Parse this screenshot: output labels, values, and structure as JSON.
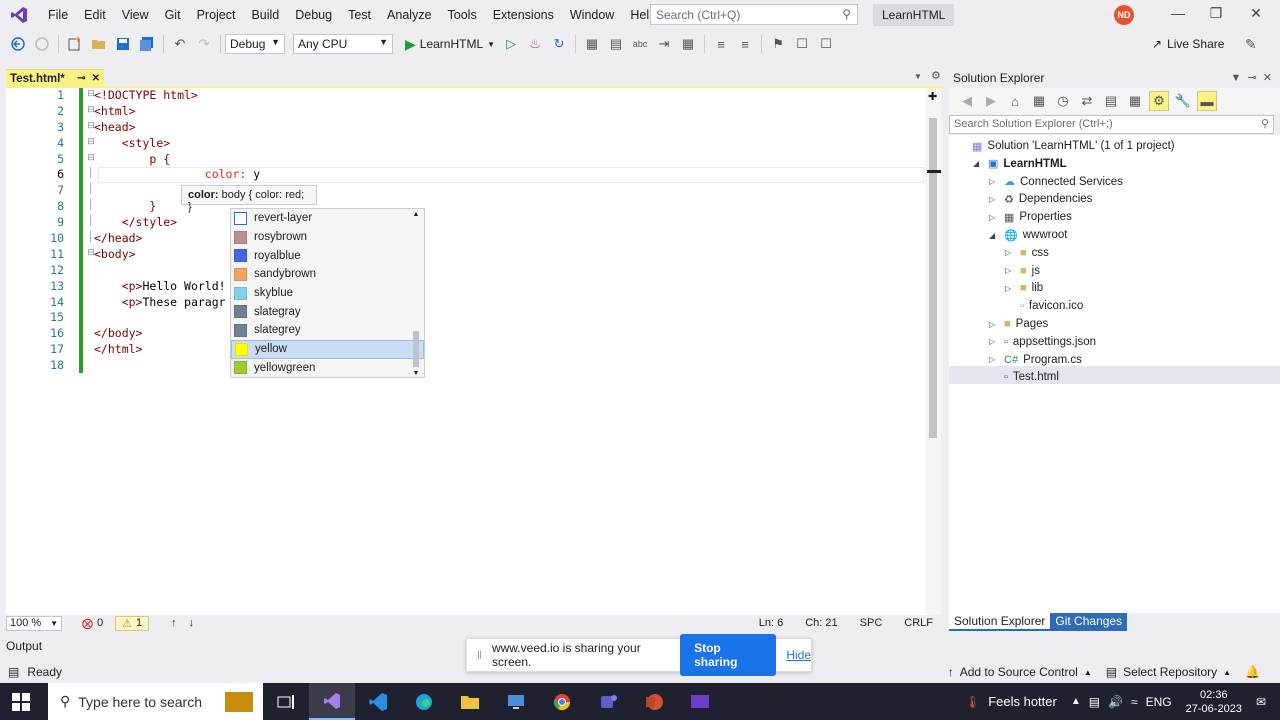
{
  "menubar": {
    "items": [
      "File",
      "Edit",
      "View",
      "Git",
      "Project",
      "Build",
      "Debug",
      "Test",
      "Analyze",
      "Tools",
      "Extensions",
      "Window",
      "Help"
    ],
    "search_placeholder": "Search (Ctrl+Q)",
    "solution_name": "LearnHTML",
    "avatar_initials": "ND"
  },
  "toolbar": {
    "config": "Debug",
    "platform": "Any CPU",
    "run_target": "LearnHTML",
    "live_share": "Live Share"
  },
  "editor": {
    "tab_title": "Test.html*",
    "line_numbers": [
      "1",
      "2",
      "3",
      "4",
      "5",
      "6",
      "7",
      "8",
      "9",
      "10",
      "11",
      "12",
      "13",
      "14",
      "15",
      "16",
      "17",
      "18"
    ],
    "lines": [
      {
        "segs": [
          {
            "t": "<!DOCTYPE html>",
            "c": "tag"
          }
        ]
      },
      {
        "segs": [
          {
            "t": "<html>",
            "c": "tag"
          }
        ]
      },
      {
        "segs": [
          {
            "t": "<head>",
            "c": "tag"
          }
        ]
      },
      {
        "segs": [
          {
            "t": "    "
          },
          {
            "t": "<style>",
            "c": "tag"
          }
        ]
      },
      {
        "segs": [
          {
            "t": "        p {",
            "c": "tag"
          }
        ]
      },
      {
        "segs": [
          {
            "t": "                "
          },
          {
            "t": "color:",
            "c": "prop"
          },
          {
            "t": " y"
          }
        ]
      },
      {
        "segs": [
          {
            "t": ""
          }
        ]
      },
      {
        "segs": [
          {
            "t": "        }",
            "c": "tag"
          }
        ]
      },
      {
        "segs": [
          {
            "t": "    "
          },
          {
            "t": "</style>",
            "c": "tag"
          }
        ]
      },
      {
        "segs": [
          {
            "t": "</head>",
            "c": "tag"
          }
        ]
      },
      {
        "segs": [
          {
            "t": "<body>",
            "c": "tag"
          }
        ]
      },
      {
        "segs": [
          {
            "t": ""
          }
        ]
      },
      {
        "segs": [
          {
            "t": "    "
          },
          {
            "t": "<p>",
            "c": "tag"
          },
          {
            "t": "Hello World!"
          }
        ]
      },
      {
        "segs": [
          {
            "t": "    "
          },
          {
            "t": "<p>",
            "c": "tag"
          },
          {
            "t": "These paragr"
          },
          {
            "t": "                      "
          },
          {
            "t": "p>",
            "c": "tag"
          }
        ]
      },
      {
        "segs": [
          {
            "t": ""
          }
        ]
      },
      {
        "segs": [
          {
            "t": "</body>",
            "c": "tag"
          }
        ]
      },
      {
        "segs": [
          {
            "t": "</html>",
            "c": "tag"
          }
        ]
      },
      {
        "segs": [
          {
            "t": ""
          }
        ]
      }
    ],
    "tooltip_key": "color:",
    "tooltip_val": "body { color: red; }",
    "completion": [
      {
        "label": "revert-layer",
        "swatch": "icon"
      },
      {
        "label": "rosybrown",
        "swatch": "#bc8f8f"
      },
      {
        "label": "royalblue",
        "swatch": "#4169e1"
      },
      {
        "label": "sandybrown",
        "swatch": "#f4a460"
      },
      {
        "label": "skyblue",
        "swatch": "#87ceeb"
      },
      {
        "label": "slategray",
        "swatch": "#708090"
      },
      {
        "label": "slategrey",
        "swatch": "#708090"
      },
      {
        "label": "yellow",
        "swatch": "#ffff00",
        "selected": true
      },
      {
        "label": "yellowgreen",
        "swatch": "#9acd32"
      }
    ],
    "zoom": "100 %",
    "errors": "0",
    "warnings": "1",
    "ln": "Ln: 6",
    "ch": "Ch: 21",
    "spc": "SPC",
    "crlf": "CRLF"
  },
  "solution_explorer": {
    "title": "Solution Explorer",
    "search_placeholder": "Search Solution Explorer (Ctrl+;)",
    "tree": [
      {
        "label": "Solution 'LearnHTML' (1 of 1 project)",
        "level": 0,
        "chev": "",
        "icon": "sln"
      },
      {
        "label": "LearnHTML",
        "level": 1,
        "chev": "open",
        "icon": "proj",
        "bold": true
      },
      {
        "label": "Connected Services",
        "level": 2,
        "chev": "closed",
        "icon": "svc"
      },
      {
        "label": "Dependencies",
        "level": 2,
        "chev": "closed",
        "icon": "dep"
      },
      {
        "label": "Properties",
        "level": 2,
        "chev": "closed",
        "icon": "prop"
      },
      {
        "label": "wwwroot",
        "level": 2,
        "chev": "open",
        "icon": "globe"
      },
      {
        "label": "css",
        "level": 3,
        "chev": "closed",
        "icon": "folder"
      },
      {
        "label": "js",
        "level": 3,
        "chev": "closed",
        "icon": "folder"
      },
      {
        "label": "lib",
        "level": 3,
        "chev": "closed",
        "icon": "folder"
      },
      {
        "label": "favicon.ico",
        "level": 3,
        "chev": "",
        "icon": "file"
      },
      {
        "label": "Pages",
        "level": 2,
        "chev": "closed",
        "icon": "folder"
      },
      {
        "label": "appsettings.json",
        "level": 2,
        "chev": "closed",
        "icon": "json"
      },
      {
        "label": "Program.cs",
        "level": 2,
        "chev": "closed",
        "icon": "cs"
      },
      {
        "label": "Test.html",
        "level": 2,
        "chev": "",
        "icon": "html",
        "selected": true
      }
    ],
    "tabs": [
      "Solution Explorer",
      "Git Changes"
    ]
  },
  "output_label": "Output",
  "status": {
    "ready": "Ready",
    "add_source": "Add to Source Control",
    "select_repo": "Select Repository"
  },
  "share": {
    "text": "www.veed.io is sharing your screen.",
    "stop": "Stop sharing",
    "hide": "Hide"
  },
  "taskbar": {
    "search_placeholder": "Type here to search",
    "weather": "Feels hotter",
    "lang": "ENG",
    "time": "02:36",
    "date": "27-06-2023"
  }
}
